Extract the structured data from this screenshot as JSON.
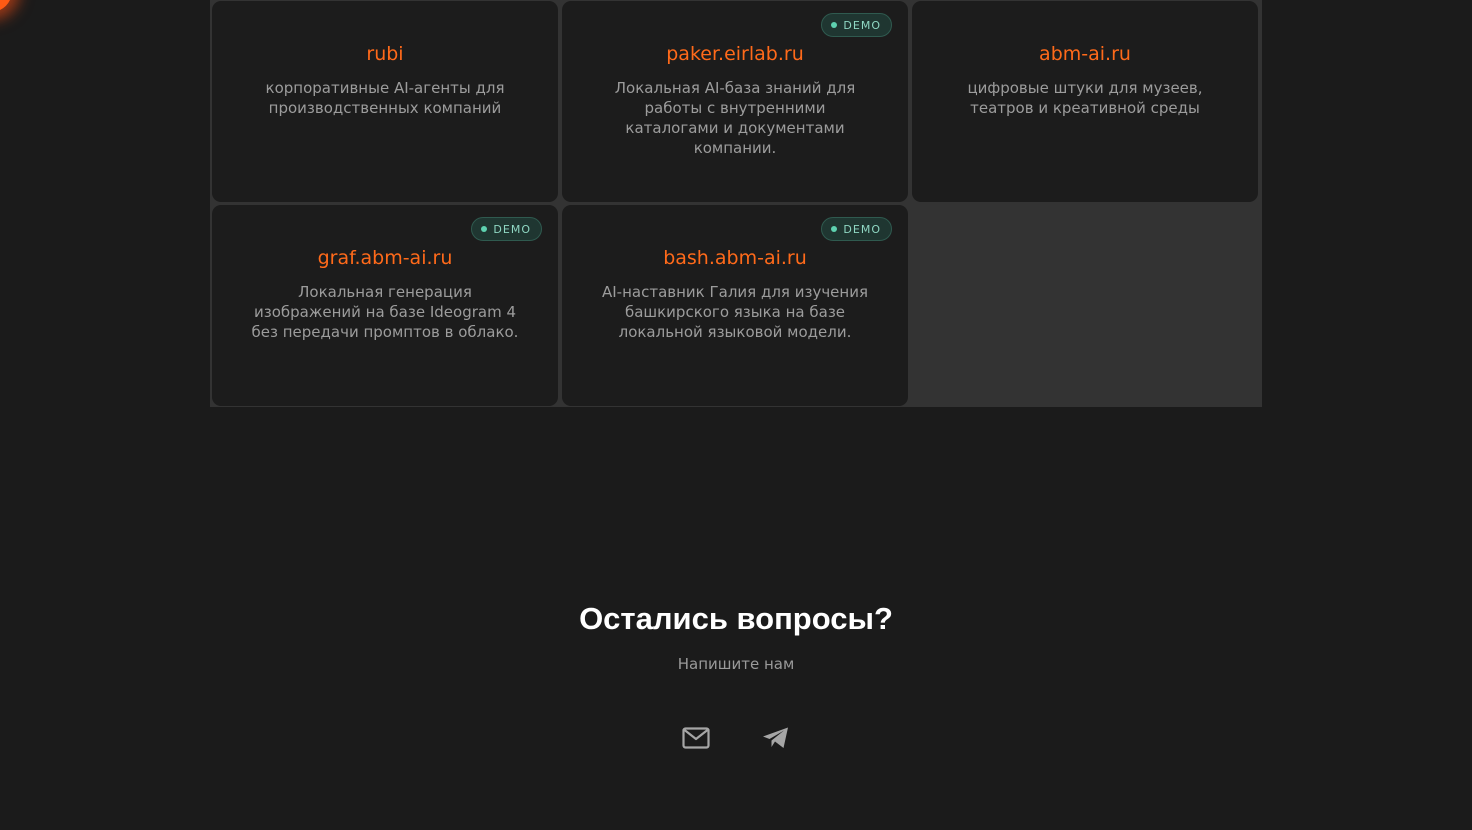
{
  "projects": [
    {
      "title": "rubi",
      "description": "корпоративные AI-агенты для производственных компаний",
      "badge": ""
    },
    {
      "title": "paker.eirlab.ru",
      "description": "Локальная AI-база знаний для работы с внутренними каталогами и документами компании.",
      "badge": "DEMO"
    },
    {
      "title": "abm-ai.ru",
      "description": "цифровые штуки для музеев, театров и креативной среды",
      "badge": ""
    },
    {
      "title": "graf.abm-ai.ru",
      "description": "Локальная генерация изображений на базе Ideogram 4 без передачи промптов в облако.",
      "badge": "DEMO"
    },
    {
      "title": "bash.abm-ai.ru",
      "description": "AI-наставник Галия для изучения башкирского языка на базе локальной языковой модели.",
      "badge": "DEMO"
    }
  ],
  "contact": {
    "title": "Остались вопросы?",
    "subtitle": "Напишите нам",
    "icons": [
      "mail-icon",
      "telegram-icon"
    ]
  },
  "colors": {
    "background": "#1b1b1b",
    "card": "#1c1c1c",
    "accent": "#ff6a1a",
    "badge_text": "#8fd7c3",
    "badge_dot": "#5ed1b0"
  }
}
